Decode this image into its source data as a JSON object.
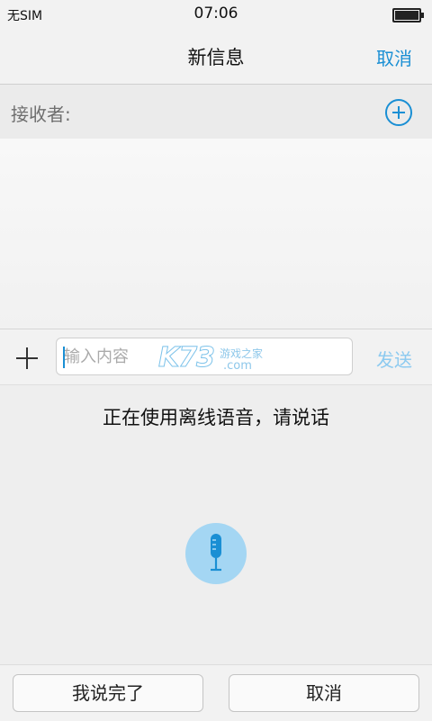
{
  "status_bar": {
    "carrier": "无SIM",
    "time": "07:06",
    "battery_level": 1.0
  },
  "header": {
    "title": "新信息",
    "cancel_label": "取消"
  },
  "recipient": {
    "label": "接收者:",
    "add_icon": "plus-circle-icon"
  },
  "composer": {
    "attach_icon": "plus-icon",
    "placeholder": "输入内容",
    "value": "",
    "send_label": "发送"
  },
  "watermark": {
    "logo": "K73",
    "text_cn": "游戏之家",
    "text_com": ".com"
  },
  "voice": {
    "status_text": "正在使用离线语音，请说话",
    "mic_icon": "microphone-icon"
  },
  "bottom": {
    "done_label": "我说完了",
    "cancel_label": "取消"
  },
  "colors": {
    "accent": "#1a8fd4",
    "send_disabled": "#8ccaf0",
    "mic_circle": "#a4d6f3",
    "mic_glyph": "#1a8fd4"
  }
}
